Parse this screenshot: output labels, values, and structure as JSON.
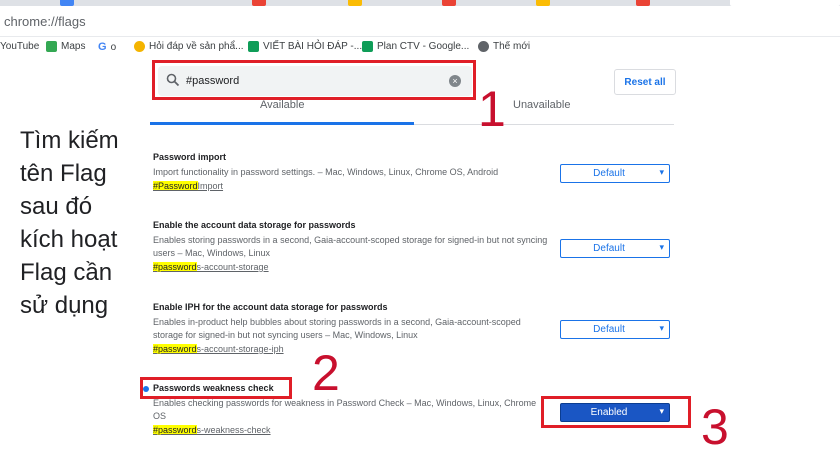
{
  "browser": {
    "url": "chrome://flags",
    "bookmarks": [
      {
        "label": "YouTube",
        "icon": "youtube-icon"
      },
      {
        "label": "Maps",
        "icon": "maps-icon"
      },
      {
        "label": "o",
        "icon": "google-icon"
      },
      {
        "label": "Hỏi đáp về sản phẩ...",
        "icon": "hoidap-icon"
      },
      {
        "label": "VIẾT BÀI HỎI ĐÁP -...",
        "icon": "sheets-icon"
      },
      {
        "label": "Plan CTV - Google...",
        "icon": "sheets-icon"
      },
      {
        "label": "Thế mới",
        "icon": "globe-icon"
      }
    ]
  },
  "flags_page": {
    "search_value": "#password",
    "reset_label": "Reset all",
    "tabs": [
      "Available",
      "Unavailable"
    ]
  },
  "instruction": {
    "lines": [
      "Tìm kiếm",
      "tên Flag",
      "sau đó",
      "kích hoạt",
      "Flag cần",
      "sử dụng"
    ]
  },
  "annotations": {
    "step1": "1",
    "step2": "2",
    "step3": "3",
    "color": "#e01e27"
  },
  "flags": [
    {
      "title": "Password import",
      "desc": "Import functionality in password settings. – Mac, Windows, Linux, Chrome OS, Android",
      "hash_hl": "#Password",
      "hash_rest": "Import",
      "value": "Default"
    },
    {
      "title": "Enable the account data storage for passwords",
      "desc": "Enables storing passwords in a second, Gaia-account-scoped storage for signed-in but not syncing users – Mac, Windows, Linux",
      "hash_hl": "#password",
      "hash_rest": "s-account-storage",
      "value": "Default"
    },
    {
      "title": "Enable IPH for the account data storage for passwords",
      "desc": "Enables in-product help bubbles about storing passwords in a second, Gaia-account-scoped storage for signed-in but not syncing users – Mac, Windows, Linux",
      "hash_hl": "#password",
      "hash_rest": "s-account-storage-iph",
      "value": "Default"
    },
    {
      "title": "Passwords weakness check",
      "desc": "Enables checking passwords for weakness in Password Check – Mac, Windows, Linux, Chrome OS",
      "hash_hl": "#password",
      "hash_rest": "s-weakness-check",
      "value": "Enabled"
    }
  ]
}
